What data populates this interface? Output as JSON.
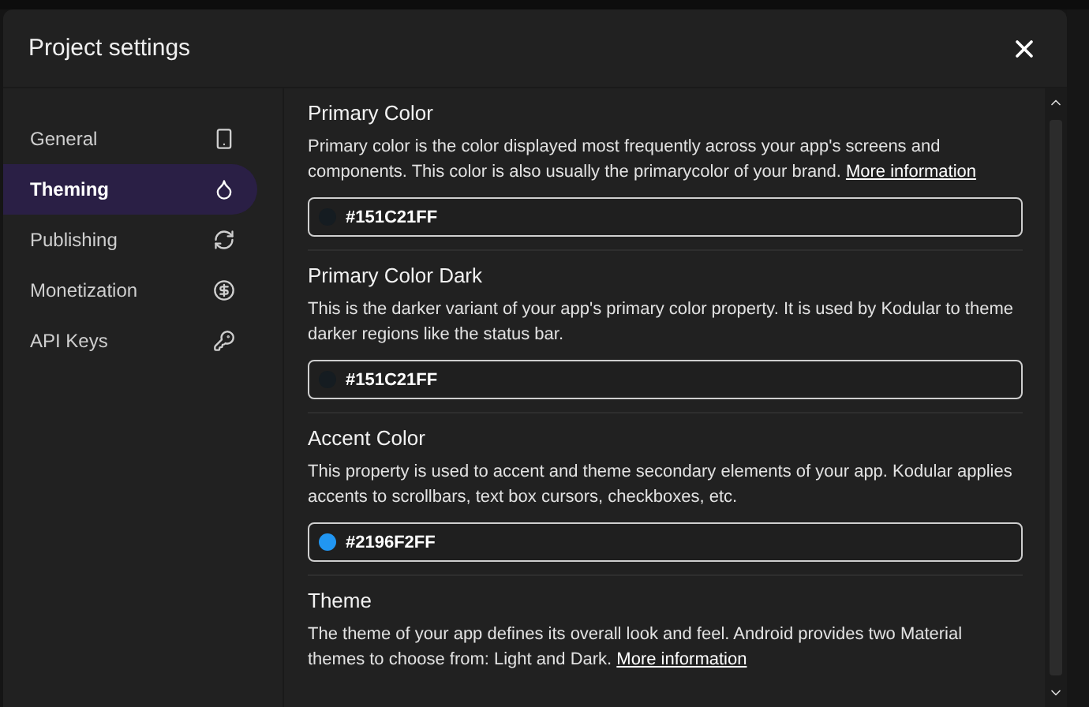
{
  "window": {
    "title": "Project settings"
  },
  "sidebar": {
    "items": [
      {
        "label": "General",
        "selected": false
      },
      {
        "label": "Theming",
        "selected": true
      },
      {
        "label": "Publishing",
        "selected": false
      },
      {
        "label": "Monetization",
        "selected": false
      },
      {
        "label": "API Keys",
        "selected": false
      }
    ]
  },
  "sections": [
    {
      "title": "Primary Color",
      "description": "Primary color is the color displayed most frequently across your app's screens and components. This color is also usually the primarycolor of your brand.",
      "link": "More information",
      "value": "#151C21FF",
      "color": "#151c21"
    },
    {
      "title": "Primary Color Dark",
      "description": "This is the darker variant of your app's primary color property. It is used by Kodular to theme darker regions like the status bar.",
      "value": "#151C21FF",
      "color": "#151c21"
    },
    {
      "title": "Accent Color",
      "description": "This property is used to accent and theme secondary elements of your app. Kodular applies accents to scrollbars, text box cursors, checkboxes, etc.",
      "value": "#2196F2FF",
      "color": "#2196f2"
    },
    {
      "title": "Theme",
      "description": "The theme of your app defines its overall look and feel. Android provides two Material themes to choose from: Light and Dark.",
      "link": "More information"
    }
  ]
}
